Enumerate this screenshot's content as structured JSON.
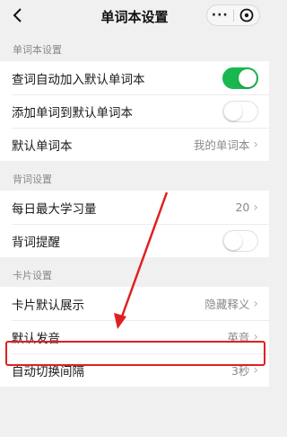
{
  "header": {
    "title": "单词本设置",
    "more_label": "···"
  },
  "sections": [
    {
      "title": "单词本设置",
      "rows": [
        {
          "label": "查词自动加入默认单词本",
          "type": "toggle",
          "on": true
        },
        {
          "label": "添加单词到默认单词本",
          "type": "toggle",
          "on": false
        },
        {
          "label": "默认单词本",
          "type": "select",
          "value": "我的单词本"
        }
      ]
    },
    {
      "title": "背词设置",
      "rows": [
        {
          "label": "每日最大学习量",
          "type": "select",
          "value": "20"
        },
        {
          "label": "背词提醒",
          "type": "toggle",
          "on": false
        }
      ]
    },
    {
      "title": "卡片设置",
      "rows": [
        {
          "label": "卡片默认展示",
          "type": "select",
          "value": "隐藏释义"
        },
        {
          "label": "默认发音",
          "type": "select",
          "value": "英音"
        },
        {
          "label": "自动切换间隔",
          "type": "select",
          "value": "3秒"
        }
      ]
    }
  ],
  "chevron": "›",
  "colors": {
    "toggle_on": "#19b84f",
    "annotation": "#e02020"
  }
}
